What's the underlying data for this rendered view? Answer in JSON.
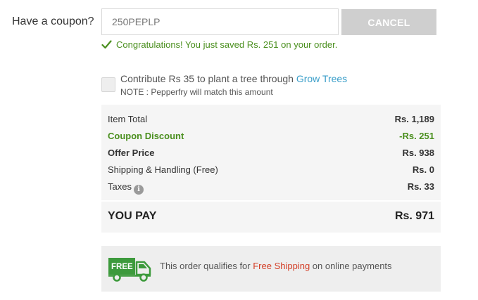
{
  "coupon": {
    "label": "Have a coupon?",
    "code": "250PEPLP",
    "cancel_label": "CANCEL",
    "success_message": "Congratulations! You just saved Rs. 251 on your order."
  },
  "contribution": {
    "text": "Contribute Rs 35 to plant a tree through ",
    "link_text": "Grow Trees",
    "note": "NOTE : Pepperfry will match this amount",
    "checked": false
  },
  "summary": {
    "item_total": {
      "label": "Item Total",
      "value": "Rs. 1,189"
    },
    "coupon_discount": {
      "label": "Coupon Discount",
      "value": "-Rs. 251"
    },
    "offer_price": {
      "label": "Offer Price",
      "value": "Rs. 938"
    },
    "shipping": {
      "label": "Shipping & Handling (Free)",
      "value": "Rs. 0"
    },
    "taxes": {
      "label": "Taxes",
      "value": "Rs. 33"
    },
    "you_pay": {
      "label": "YOU PAY",
      "value": "Rs. 971"
    }
  },
  "free_shipping": {
    "badge": "FREE",
    "text_before": "This order qualifies for ",
    "highlight": "Free Shipping",
    "text_after": " on online payments"
  },
  "colors": {
    "success_green": "#4a8f1e",
    "link_blue": "#3a9ec9",
    "highlight_red": "#d33e26",
    "cancel_grey": "#cfcfcf"
  }
}
